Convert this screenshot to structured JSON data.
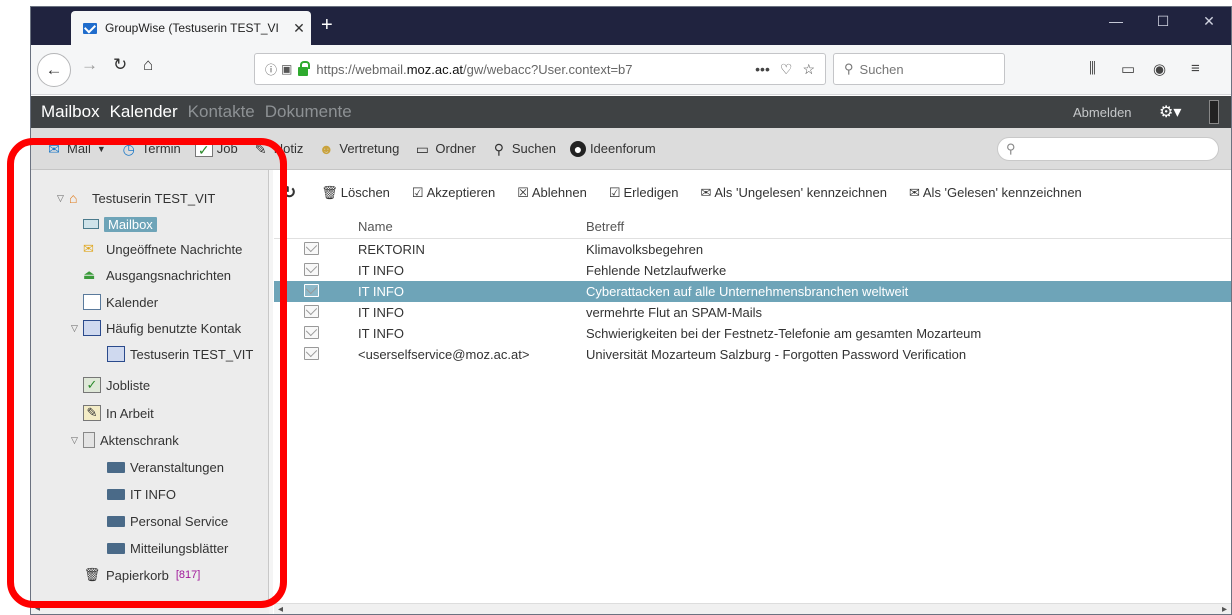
{
  "browser": {
    "tab_title": "GroupWise (Testuserin TEST_VI",
    "tab_close": "✕",
    "new_tab": "+",
    "url_prefix": "https://webmail.",
    "url_domain": "moz.ac.at",
    "url_suffix": "/gw/webacc?User.context=b7",
    "url_more": "•••",
    "search_placeholder": "Suchen",
    "window_controls": [
      "—",
      "☐",
      "✕"
    ]
  },
  "app_nav": {
    "items": [
      {
        "label": "Mailbox",
        "active": true
      },
      {
        "label": "Kalender",
        "active": true
      },
      {
        "label": "Kontakte",
        "active": false
      },
      {
        "label": "Dokumente",
        "active": false
      }
    ],
    "logout": "Abmelden"
  },
  "toolbar": {
    "mail": "Mail",
    "termin": "Termin",
    "job": "Job",
    "notiz": "Notiz",
    "vertretung": "Vertretung",
    "ordner": "Ordner",
    "suchen": "Suchen",
    "ideenforum": "Ideenforum",
    "search_placeholder": ""
  },
  "tree": {
    "root": "Testuserin TEST_VIT",
    "items": [
      {
        "label": "Mailbox",
        "icon": "mailbox-icon"
      },
      {
        "label": "Ungeöffnete Nachrichte",
        "icon": "envelope-icon"
      },
      {
        "label": "Ausgangsnachrichten",
        "icon": "outbox-icon"
      },
      {
        "label": "Kalender",
        "icon": "calendar-icon"
      },
      {
        "label": "Häufig benutzte Kontak",
        "icon": "contacts-icon"
      },
      {
        "label": "Testuserin TEST_VIT",
        "icon": "contact-card-icon"
      },
      {
        "label": "Jobliste",
        "icon": "tasklist-icon"
      },
      {
        "label": "In Arbeit",
        "icon": "drafts-icon"
      },
      {
        "label": "Aktenschrank",
        "icon": "cabinet-icon"
      },
      {
        "label": "Veranstaltungen",
        "icon": "folder-icon"
      },
      {
        "label": "IT INFO",
        "icon": "folder-icon"
      },
      {
        "label": "Personal Service",
        "icon": "folder-icon"
      },
      {
        "label": "Mitteilungsblätter",
        "icon": "folder-icon"
      },
      {
        "label": "Papierkorb",
        "icon": "trash-icon"
      }
    ],
    "trash_count": "[817]"
  },
  "actions": {
    "loeschen": "Löschen",
    "akzeptieren": "Akzeptieren",
    "ablehnen": "Ablehnen",
    "erledigen": "Erledigen",
    "ungelesen": "Als 'Ungelesen' kennzeichnen",
    "gelesen": "Als 'Gelesen' kennzeichnen"
  },
  "columns": {
    "name": "Name",
    "betreff": "Betreff"
  },
  "messages": [
    {
      "name": "REKTORIN",
      "subject": "Klimavolksbegehren"
    },
    {
      "name": "IT INFO",
      "subject": "Fehlende Netzlaufwerke"
    },
    {
      "name": "IT INFO",
      "subject": "Cyberattacken auf alle Unternehmensbranchen weltweit"
    },
    {
      "name": "IT INFO",
      "subject": "vermehrte Flut an SPAM-Mails"
    },
    {
      "name": "IT INFO",
      "subject": "Schwierigkeiten bei der Festnetz-Telefonie am gesamten Mozarteum"
    },
    {
      "name": "<userselfservice@moz.ac.at>",
      "subject": "Universität Mozarteum Salzburg - Forgotten Password Verification"
    }
  ],
  "colors": {
    "accent": "#6ea4b8",
    "titlebar": "#20233f",
    "appnav": "#3f4244",
    "annotation": "#ff0000"
  }
}
